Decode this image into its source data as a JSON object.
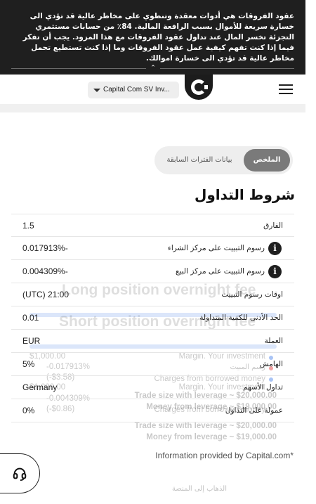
{
  "risk_banner": {
    "text": "عقود الفروقات هي أدوات معقدة وتنطوي على مخاطر عالية قد تؤدي الى خسارة سريعة للأموال بسبب الرافعة المالية. 84٪ من حسابات مستثمري التجزئة تخسر المال عند تداول عقود الفروقات مع هذا المزود. يجب أن تفكر فيما إذا كنت تفهم كيفية عمل عقود الفروقات وما إذا كنت تستطيع تحمل مخاطر عالية قد تؤدي الى خسارة اموالك.",
    "toggle_glyph": "⌃"
  },
  "header": {
    "entity_selector": "Capital Com SV Inv...",
    "logo_icon": "capital-com-logo",
    "menu_icon": "hamburger-menu-icon"
  },
  "tabs": [
    {
      "label": "الملخص",
      "active": true
    },
    {
      "label": "بيانات الفترات السابقة",
      "active": false
    }
  ],
  "section_title": "شروط التداول",
  "trading_conditions": [
    {
      "label": "الفارق",
      "value": "1.5",
      "info": false
    },
    {
      "label": "رسوم التبييت على مركز الشراء",
      "value": "0.017913%-",
      "info": true
    },
    {
      "label": "رسوم التبييت على مركز البيع",
      "value": "0.004309%-",
      "info": true
    },
    {
      "label": "اوقات رسوم التبييت",
      "value": "(UTC) 21:00",
      "info": false
    },
    {
      "label": "الحد الأدنى للكمية المتداولة",
      "value": "0.01",
      "info": false
    },
    {
      "label": "العملة",
      "value": "EUR",
      "info": false
    },
    {
      "label": "الهامش",
      "value": "5%",
      "info": false
    },
    {
      "label": "تداول الأسهم",
      "value": "Germany",
      "info": false
    },
    {
      "label": "عمولة على التداول",
      "value": "0%",
      "info": false
    }
  ],
  "ghost_calculator": {
    "long_heading": "Long position overnight fee",
    "short_heading": "Short position overnight fee",
    "long": {
      "margin_label": "Margin. Your investment",
      "margin_value": "$1,000.00",
      "fee_label": "رسم المبيت",
      "fee_value": "-0.017913%",
      "fee_amount": "(-$3.58)",
      "charges_label": "Charges from borrowed money",
      "trade_size": "Trade size with leverage ~ $20,000.00",
      "money_from_leverage": "Money from leverage ~ $19,000.00"
    },
    "short": {
      "margin_label": "Margin. Your investment",
      "margin_value": "$1,000.00",
      "fee_value": "-0.004309%",
      "fee_amount": "(-$0.86)",
      "charges_label": "Charges from borrowed money",
      "trade_size": "Trade size with leverage ~ $20,000.00",
      "money_from_leverage": "Money from leverage ~ $19,000.00"
    },
    "go_to_platform": "الذهاب إلى المنصة",
    "colors": {
      "fee_dot": "#f2a0a0",
      "margin_dot": "#a9c4f5"
    }
  },
  "source_note": "Information provided by Capital.com*",
  "support_icon": "headset-icon"
}
